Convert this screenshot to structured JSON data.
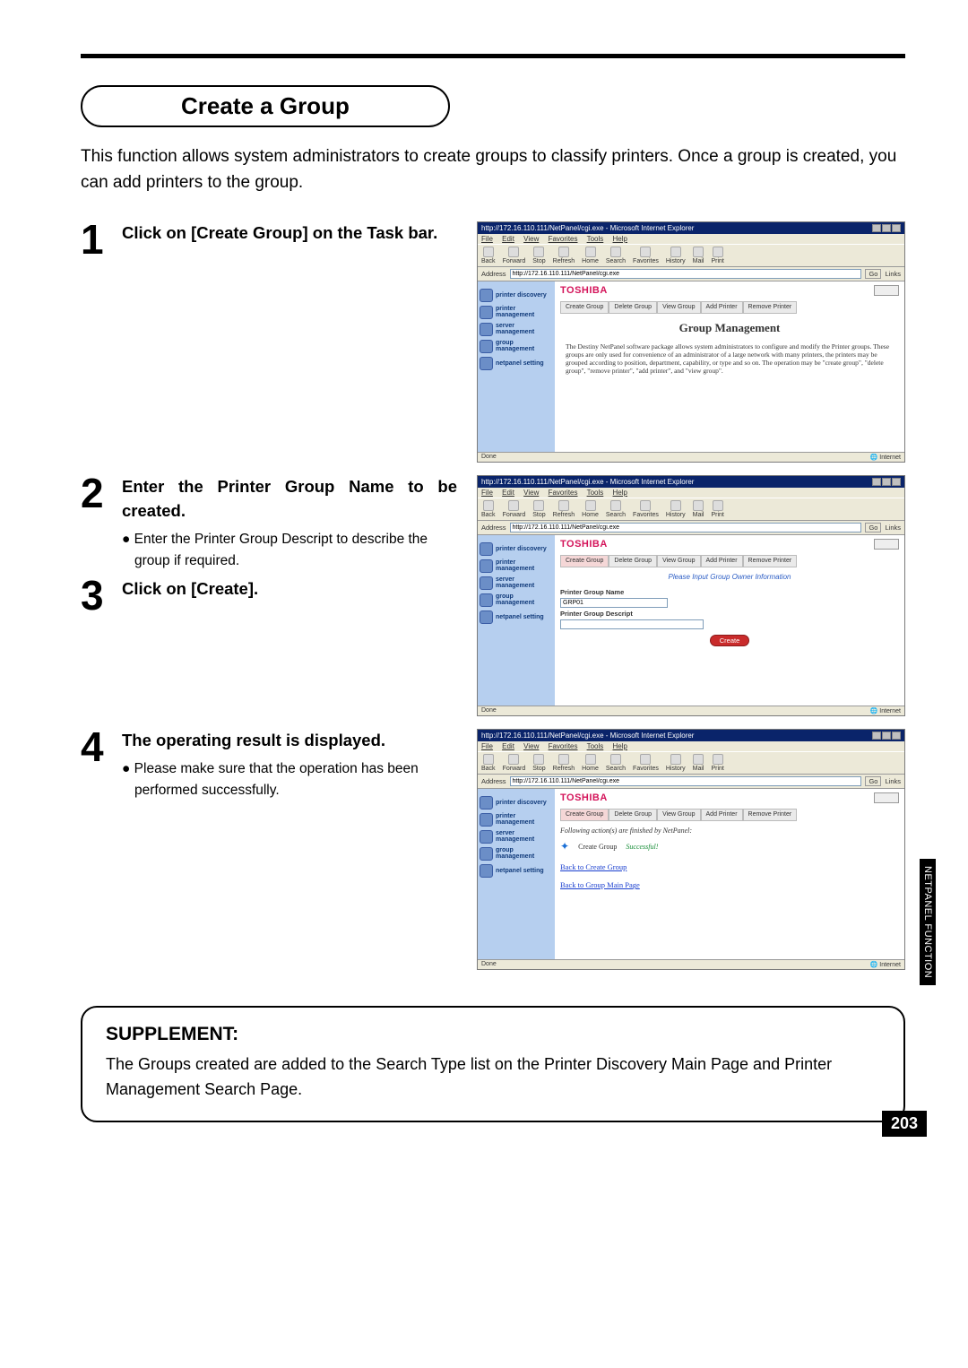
{
  "heading": "Create a Group",
  "intro": "This function allows system administrators to create groups to classify printers.  Once a group is created, you can add printers to the group.",
  "steps": {
    "s1": {
      "num": "1",
      "title": "Click on [Create Group] on the Task bar."
    },
    "s2": {
      "num": "2",
      "title": "Enter the Printer Group Name to be created.",
      "bullet": "Enter the Printer Group Descript to describe the group if required."
    },
    "s3": {
      "num": "3",
      "title": "Click on [Create]."
    },
    "s4": {
      "num": "4",
      "title": "The operating result is displayed.",
      "bullet": "Please make sure that the operation has been performed successfully."
    }
  },
  "supplement": {
    "heading": "SUPPLEMENT:",
    "text": "The Groups created are added to the Search Type list on the Printer Discovery Main Page and Printer Management Search Page."
  },
  "side_tab": "NETPANEL\nFUNCTION",
  "page_number": "203",
  "browser": {
    "title": "http://172.16.110.111/NetPanel/cgi.exe - Microsoft Internet Explorer",
    "menu": [
      "File",
      "Edit",
      "View",
      "Favorites",
      "Tools",
      "Help"
    ],
    "toolbar": [
      "Back",
      "Forward",
      "Stop",
      "Refresh",
      "Home",
      "Search",
      "Favorites",
      "History",
      "Mail",
      "Print"
    ],
    "addr_label": "Address",
    "addr_value": "http://172.16.110.111/NetPanel/cgi.exe",
    "go": "Go",
    "links": "Links",
    "status_done": "Done",
    "status_zone": "Internet"
  },
  "netpanel": {
    "logo": "TOSHIBA",
    "tabs": [
      "Create\nGroup",
      "Delete\nGroup",
      "View\nGroup",
      "Add\nPrinter",
      "Remove\nPrinter"
    ],
    "sidebar": [
      "printer\ndiscovery",
      "printer\nmanagement",
      "server\nmanagement",
      "group\nmanagement",
      "netpanel\nsetting"
    ],
    "shot1": {
      "heading": "Group Management",
      "body": "The Destiny NetPanel software package allows system administrators to configure and modify the Printer groups. These groups are only used for convenience of an administrator of a large network with many printers, the printers may be grouped according to position, department, capability, or type and so on. The operation may be \"create group\", \"delete group\", \"remove printer\", \"add printer\", and \"view group\"."
    },
    "shot2": {
      "blue_line": "Please Input Group Owner Information",
      "label_name": "Printer Group Name",
      "value_name": "GRP01",
      "label_desc": "Printer Group Descript",
      "value_desc": "",
      "button": "Create"
    },
    "shot3": {
      "intro": "Following action(s) are finished by NetPanel:",
      "action": "Create Group",
      "result": "Successful!",
      "link1": "Back to Create Group",
      "link2": "Back to Group Main Page"
    }
  }
}
